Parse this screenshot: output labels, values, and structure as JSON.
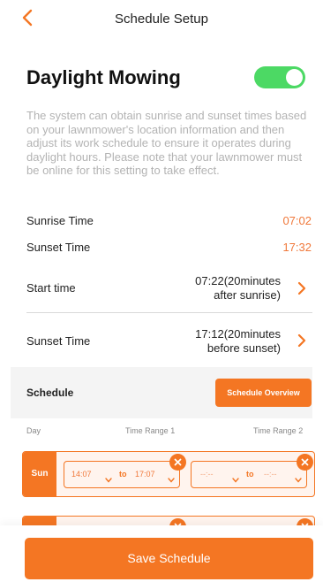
{
  "header": {
    "title": "Schedule Setup"
  },
  "daylight": {
    "title": "Daylight Mowing",
    "enabled": true,
    "description": "The system can obtain sunrise and sunset times based on your lawnmower's location information and then adjust its work schedule to ensure it operates during daylight hours. Please note that your lawnmower must be online for this setting to take effect."
  },
  "times": {
    "sunrise_label": "Sunrise Time",
    "sunrise_value": "07:02",
    "sunset_label": "Sunset Time",
    "sunset_value": "17:32"
  },
  "start": {
    "label": "Start time",
    "value_line1": "07:22(20minutes",
    "value_line2": "after sunrise)"
  },
  "end": {
    "label": "Sunset Time",
    "value_line1": "17:12(20minutes",
    "value_line2": "before sunset)"
  },
  "schedule": {
    "label": "Schedule",
    "overview_button": "Schedule Overview",
    "col_day": "Day",
    "col_range1": "Time Range 1",
    "col_range2": "Time Range 2",
    "rows": [
      {
        "day": "Sun",
        "range1": {
          "from": "14:07",
          "sep": "to",
          "to": "17:07"
        },
        "range2": {
          "from": "--:--",
          "sep": "to",
          "to": "--:--"
        }
      }
    ]
  },
  "footer": {
    "save_button": "Save Schedule"
  },
  "colors": {
    "accent": "#f47623",
    "toggle_on": "#4cd964"
  }
}
